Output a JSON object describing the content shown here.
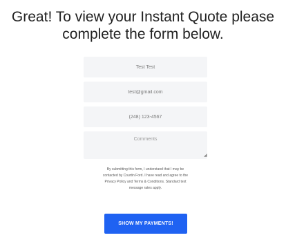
{
  "headline": {
    "line1": "Great! To view your Instant Quote please",
    "line2": "complete the form below."
  },
  "form": {
    "name_value": "Test Test",
    "email_value": "test@gmail.com",
    "phone_value": "(248) 123-4567",
    "comments_placeholder": "Comments",
    "disclaimer": {
      "line1": "By submitting this form, I understand that I may be",
      "line2": "contacted by Courtin Ford. I have read and agree to the",
      "line3": "Privacy Policy and Terms & Conditions. Standard text",
      "line4": "message rates apply."
    },
    "submit_label": "SHOW MY PAYMENTS!"
  },
  "colors": {
    "accent": "#1f62f2",
    "field_bg": "#f4f5f7"
  }
}
